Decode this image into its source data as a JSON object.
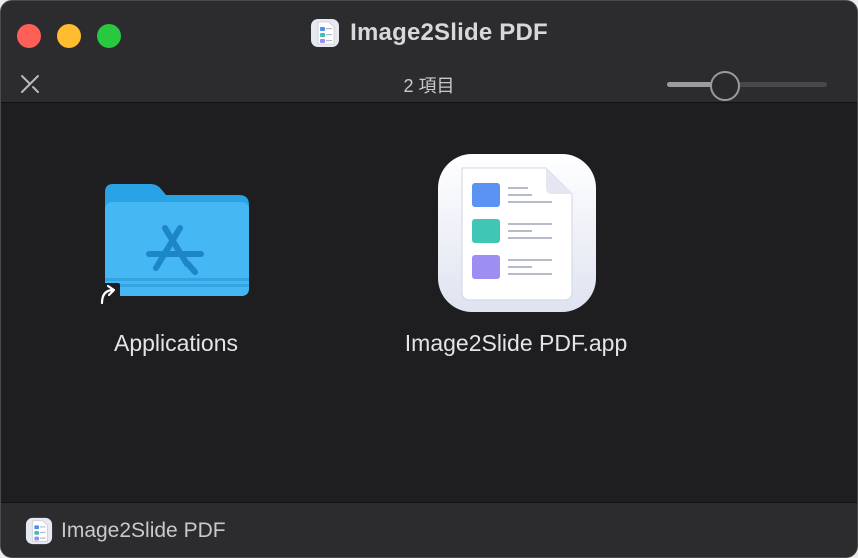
{
  "window": {
    "title": "Image2Slide PDF",
    "title_icon": "document-app-icon"
  },
  "toolbar": {
    "item_count": "2 項目",
    "icon_zoom_level": 0.33
  },
  "items": [
    {
      "label": "Applications",
      "icon": "applications-folder-alias-icon"
    },
    {
      "label": "Image2Slide PDF.app",
      "icon": "image2slide-app-icon"
    }
  ],
  "statusbar": {
    "path_label": "Image2Slide PDF",
    "path_icon": "document-app-icon"
  },
  "colors": {
    "close": "#fe5f57",
    "minimize": "#febc2e",
    "maximize": "#28c840",
    "folder_blue": "#3bb0ee",
    "background": "#1e1e21"
  }
}
